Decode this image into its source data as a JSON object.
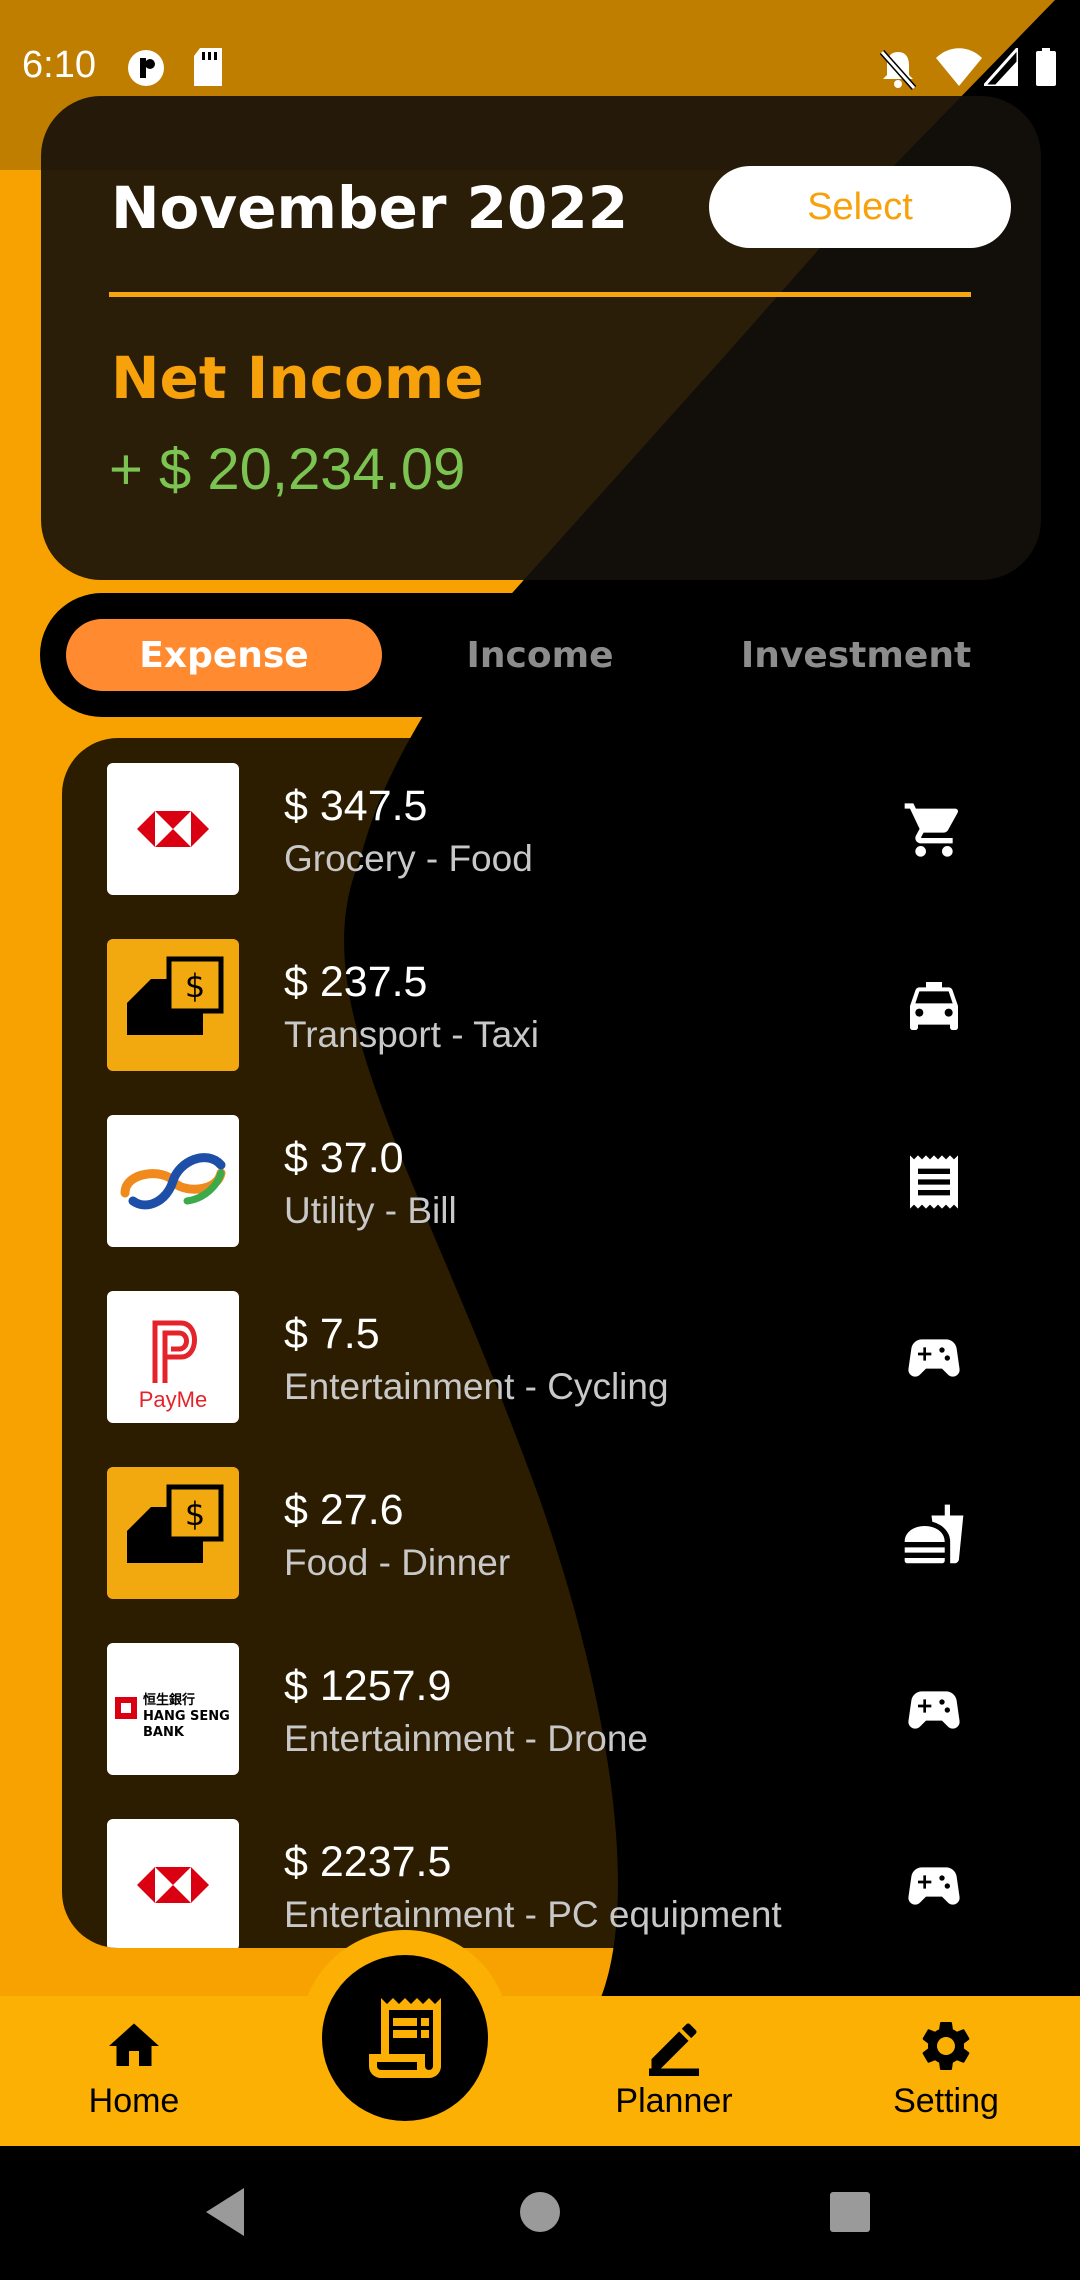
{
  "status_bar": {
    "time": "6:10",
    "icons": [
      "data-saver-icon",
      "sd-card-icon",
      "notifications-off-icon",
      "wifi-icon",
      "signal-icon",
      "battery-icon"
    ]
  },
  "summary": {
    "month": "November 2022",
    "select_label": "Select",
    "net_income_label": "Net Income",
    "net_income_value": "+ $ 20,234.09"
  },
  "tabs": [
    {
      "label": "Expense",
      "active": true
    },
    {
      "label": "Income",
      "active": false
    },
    {
      "label": "Investment",
      "active": false
    }
  ],
  "transactions": [
    {
      "amount": "$ 347.5",
      "description": "Grocery - Food",
      "logo": "hsbc-logo",
      "icon": "shopping-cart-icon"
    },
    {
      "amount": "$ 237.5",
      "description": "Transport - Taxi",
      "logo": "cash-wallet-logo",
      "icon": "taxi-icon"
    },
    {
      "amount": "$ 37.0",
      "description": "Utility - Bill",
      "logo": "fps-logo",
      "icon": "receipt-icon"
    },
    {
      "amount": "$ 7.5",
      "description": "Entertainment - Cycling",
      "logo": "payme-logo",
      "logo_text": "PayMe",
      "icon": "gamepad-icon"
    },
    {
      "amount": "$ 27.6",
      "description": "Food - Dinner",
      "logo": "cash-wallet-logo",
      "icon": "fastfood-icon"
    },
    {
      "amount": "$ 1257.9",
      "description": "Entertainment - Drone",
      "logo": "hang-seng-logo",
      "logo_text": "恒生銀行 HANG SENG BANK",
      "icon": "gamepad-icon"
    },
    {
      "amount": "$ 2237.5",
      "description": "Entertainment - PC equipment",
      "logo": "hsbc-logo",
      "icon": "gamepad-icon"
    }
  ],
  "bottom_nav": {
    "home_label": "Home",
    "planner_label": "Planner",
    "setting_label": "Setting",
    "fab_icon": "receipt-long-icon"
  },
  "colors": {
    "accent_orange": "#F7A10B",
    "tab_active": "#FF8A30",
    "income_green": "#7BC452",
    "nav_yellow": "#FBB003"
  }
}
